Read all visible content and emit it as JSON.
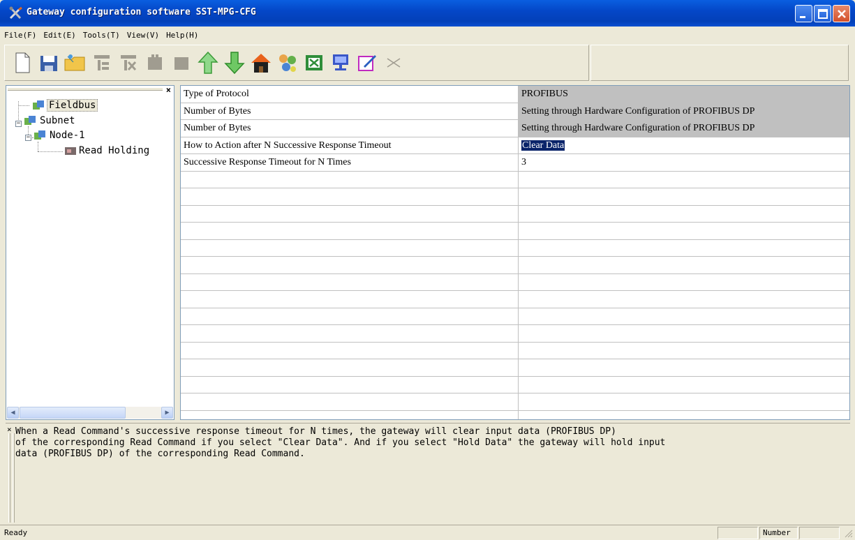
{
  "window": {
    "title": "Gateway configuration software SST-MPG-CFG"
  },
  "menu": {
    "items": [
      "File(F)",
      "Edit(E)",
      "Tools(T)",
      "View(V)",
      "Help(H)"
    ]
  },
  "toolbar": {
    "icons": [
      "new-icon",
      "save-icon",
      "open-folder-icon",
      "add-node-icon",
      "delete-node-icon",
      "add-command-icon",
      "delete-command-icon",
      "upload-icon",
      "download-icon",
      "home-icon",
      "network-icon",
      "excel-icon",
      "monitor-icon",
      "edit-icon",
      "cut-icon"
    ]
  },
  "tree": {
    "nodes": [
      {
        "label": "Fieldbus",
        "selected": true
      },
      {
        "label": "Subnet"
      },
      {
        "label": "Node-1"
      },
      {
        "label": "Read Holding"
      }
    ]
  },
  "grid": {
    "rows": [
      {
        "key": "Type of Protocol",
        "value": "PROFIBUS",
        "readonly": true
      },
      {
        "key": "Number of Bytes",
        "value": "Setting through Hardware Configuration of PROFIBUS DP",
        "readonly": true
      },
      {
        "key": "Number of Bytes",
        "value": "Setting through Hardware Configuration of PROFIBUS DP",
        "readonly": true
      },
      {
        "key": "How to Action after N Successive Response Timeout",
        "value": "Clear Data",
        "highlighted": true
      },
      {
        "key": "Successive Response Timeout for N Times",
        "value": "3"
      }
    ]
  },
  "description": {
    "text": "When a Read Command's successive response timeout for N times, the gateway will clear input data (PROFIBUS DP)\nof the corresponding Read Command if you select \"Clear Data\". And if you select \"Hold Data\" the gateway will hold input\ndata (PROFIBUS DP) of the corresponding Read Command."
  },
  "status": {
    "text": "Ready",
    "number": "Number"
  },
  "colors": {
    "title_bar": "#0447c8",
    "selection": "#0a246a",
    "readonly_cell": "#c0c0c0",
    "chrome": "#ece9d8"
  }
}
